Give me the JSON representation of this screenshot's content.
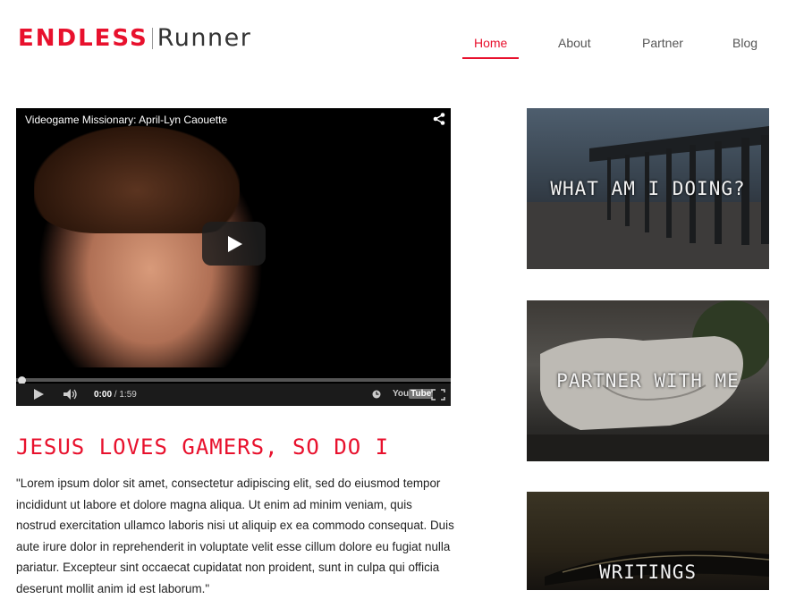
{
  "brand": {
    "part1": "ENDLESS",
    "part2": "Runner",
    "accent": "#e8112d"
  },
  "nav": {
    "items": [
      {
        "label": "Home",
        "active": true
      },
      {
        "label": "About",
        "active": false
      },
      {
        "label": "Partner",
        "active": false
      },
      {
        "label": "Blog",
        "active": false
      }
    ]
  },
  "video": {
    "title": "Videogame Missionary: April-Lyn Caouette",
    "current_time": "0:00",
    "duration": "/ 1:59",
    "progress": 0,
    "youtube_label": "You",
    "youtube_label_tube": "Tube"
  },
  "article": {
    "heading": "JESUS LOVES GAMERS, SO DO I",
    "body": "\"Lorem ipsum dolor sit amet, consectetur adipiscing elit, sed do eiusmod tempor incididunt ut labore et dolore magna aliqua. Ut enim ad minim veniam, quis nostrud exercitation ullamco laboris nisi ut aliquip ex ea commodo consequat. Duis aute irure dolor in reprehenderit in voluptate velit esse cillum dolore eu fugiat nulla pariatur. Excepteur sint occaecat cupidatat non proident, sunt in culpa qui officia deserunt mollit anim id est laborum.\""
  },
  "cards": [
    {
      "label": "WHAT AM I DOING?"
    },
    {
      "label": "PARTNER WITH ME"
    },
    {
      "label": "WRITINGS"
    }
  ]
}
